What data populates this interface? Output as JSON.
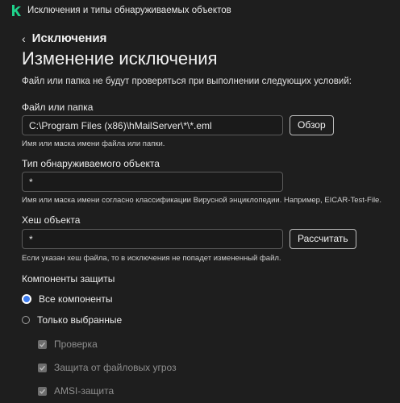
{
  "titlebar": {
    "title": "Исключения и типы обнаруживаемых объектов",
    "logo_letter": "k",
    "logo_color": "#1fd18a"
  },
  "nav": {
    "back_label": "Исключения"
  },
  "page": {
    "heading": "Изменение исключения",
    "intro": "Файл или папка не будут проверяться при выполнении следующих условий:"
  },
  "file": {
    "label": "Файл или папка",
    "value": "C:\\Program Files (x86)\\hMailServer\\*\\*.eml",
    "browse_label": "Обзор",
    "hint": "Имя или маска имени файла или папки."
  },
  "object_type": {
    "label": "Тип обнаруживаемого объекта",
    "value": "*",
    "hint": "Имя или маска имени согласно классификации Вирусной энциклопедии. Например, EICAR-Test-File."
  },
  "hash": {
    "label": "Хеш объекта",
    "value": "*",
    "calc_label": "Рассчитать",
    "hint": "Если указан хеш файла, то в исключения не попадет измененный файл."
  },
  "components": {
    "label": "Компоненты защиты",
    "options": [
      {
        "label": "Все компоненты",
        "selected": true
      },
      {
        "label": "Только выбранные",
        "selected": false
      }
    ],
    "items": [
      {
        "label": "Проверка",
        "checked": true,
        "disabled": true
      },
      {
        "label": "Защита от файловых угроз",
        "checked": true,
        "disabled": true
      },
      {
        "label": "AMSI-защита",
        "checked": true,
        "disabled": true
      }
    ]
  },
  "colors": {
    "accent": "#3d7cf0",
    "background": "#1e1e1e"
  }
}
